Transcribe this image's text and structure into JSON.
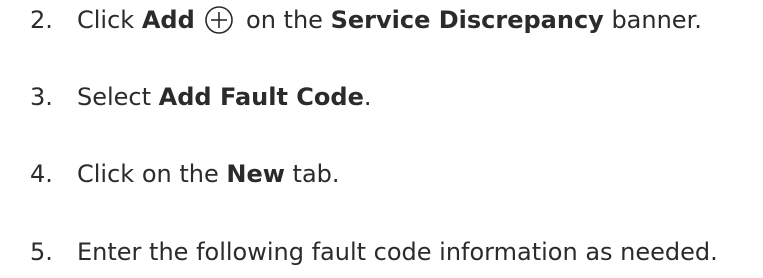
{
  "steps": [
    {
      "number": "2.",
      "parts": [
        "Click ",
        "Add",
        " on the ",
        "Service Discrepancy",
        " banner."
      ],
      "icon": "add-circle-icon"
    },
    {
      "number": "3.",
      "parts": [
        "Select ",
        "Add Fault Code",
        "."
      ]
    },
    {
      "number": "4.",
      "parts": [
        "Click on the ",
        "New",
        " tab."
      ]
    },
    {
      "number": "5.",
      "parts": [
        "Enter the following fault code information as needed."
      ]
    }
  ],
  "colors": {
    "text": "#2b2b2b"
  }
}
